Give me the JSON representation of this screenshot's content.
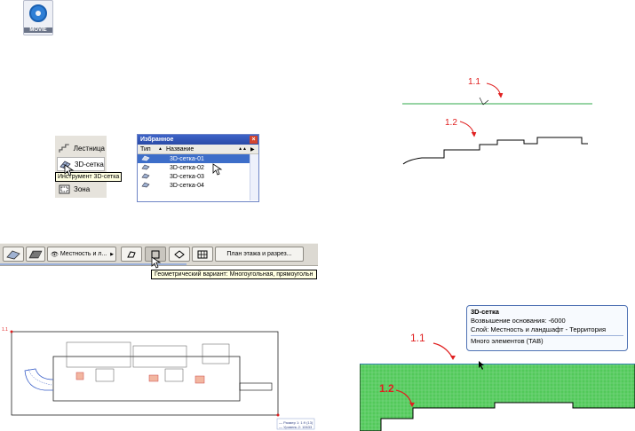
{
  "movie": {
    "label": "MOVIE",
    "icon": "movie-file-icon"
  },
  "toolbox": {
    "items": [
      {
        "label": "Лестница",
        "icon": "stair-icon"
      },
      {
        "label": "3D-сетка",
        "icon": "mesh-icon"
      },
      {
        "label": "Зона",
        "icon": "zone-icon"
      }
    ],
    "tooltip": "Инструмент 3D-сетка"
  },
  "favorites": {
    "title": "Избранное",
    "col_type": "Тип",
    "col_name": "Название",
    "rows": [
      "3D-сетка-01",
      "3D-сетка-02",
      "3D-сетка-03",
      "3D-сетка-04"
    ]
  },
  "toolbar": {
    "layer_label": "Местность и л...",
    "view_button": "План этажа и разрез...",
    "geometry_tooltip": "Геометрический вариант: Многоугольная, прямоугольн"
  },
  "callouts": {
    "top_1": "1.1",
    "top_2": "1.2",
    "bottom_1": "1.1",
    "bottom_2": "1.2",
    "plan_1": "1.1"
  },
  "info_tip": {
    "title": "3D-сетка",
    "elevation": "Возвышение основания: -6000",
    "layer": "Слой: Местность и ландшафт - Территория",
    "footer": "Много элементов (TAB)"
  },
  "plan_legend": {
    "line1": "— Размер 1: 1:9 (13)",
    "line2": "— Уровень 2:  10633"
  },
  "colors": {
    "accent_red": "#e02020",
    "mesh_green": "#52c95a",
    "line_green": "#2fa84a"
  }
}
